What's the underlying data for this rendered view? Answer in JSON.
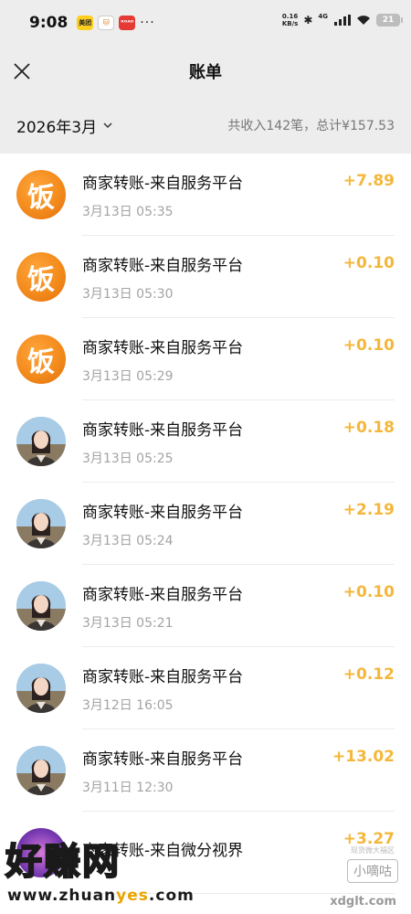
{
  "status_bar": {
    "time": "9:08",
    "notif_meituan": "美团",
    "notif_red": "ᴿᴼᴬᴰ",
    "more": "···",
    "net_speed_value": "0.16",
    "net_speed_unit": "KB/s",
    "network": "4G",
    "battery": "21"
  },
  "nav": {
    "title": "账单"
  },
  "filter": {
    "month": "2026年3月",
    "summary": "共收入142笔，总计¥157.53"
  },
  "transactions": [
    {
      "title": "商家转账-来自服务平台",
      "time": "3月13日 05:35",
      "amount": "+7.89",
      "avatar": "fan",
      "avatar_text": "饭"
    },
    {
      "title": "商家转账-来自服务平台",
      "time": "3月13日 05:30",
      "amount": "+0.10",
      "avatar": "fan",
      "avatar_text": "饭"
    },
    {
      "title": "商家转账-来自服务平台",
      "time": "3月13日 05:29",
      "amount": "+0.10",
      "avatar": "fan",
      "avatar_text": "饭"
    },
    {
      "title": "商家转账-来自服务平台",
      "time": "3月13日 05:25",
      "amount": "+0.18",
      "avatar": "person"
    },
    {
      "title": "商家转账-来自服务平台",
      "time": "3月13日 05:24",
      "amount": "+2.19",
      "avatar": "person"
    },
    {
      "title": "商家转账-来自服务平台",
      "time": "3月13日 05:21",
      "amount": "+0.10",
      "avatar": "person"
    },
    {
      "title": "商家转账-来自服务平台",
      "time": "3月12日 16:05",
      "amount": "+0.12",
      "avatar": "person"
    },
    {
      "title": "商家转账-来自服务平台",
      "time": "3月11日 12:30",
      "amount": "+13.02",
      "avatar": "person"
    },
    {
      "title": "商家转账-来自微分视界",
      "time": "",
      "amount": "+3.27",
      "avatar": "game"
    }
  ],
  "watermark": {
    "logo": "好赚网",
    "url_a": "www.zhuan",
    "url_b": "yes",
    "url_c": ".com",
    "right_small": "现货微大福区",
    "right_badge": "小嘀咕",
    "right_url": "xdglt.com"
  },
  "colors": {
    "amount": "#f4b73b",
    "header_bg": "#ededed",
    "fan_avatar": "#f38b1c"
  }
}
